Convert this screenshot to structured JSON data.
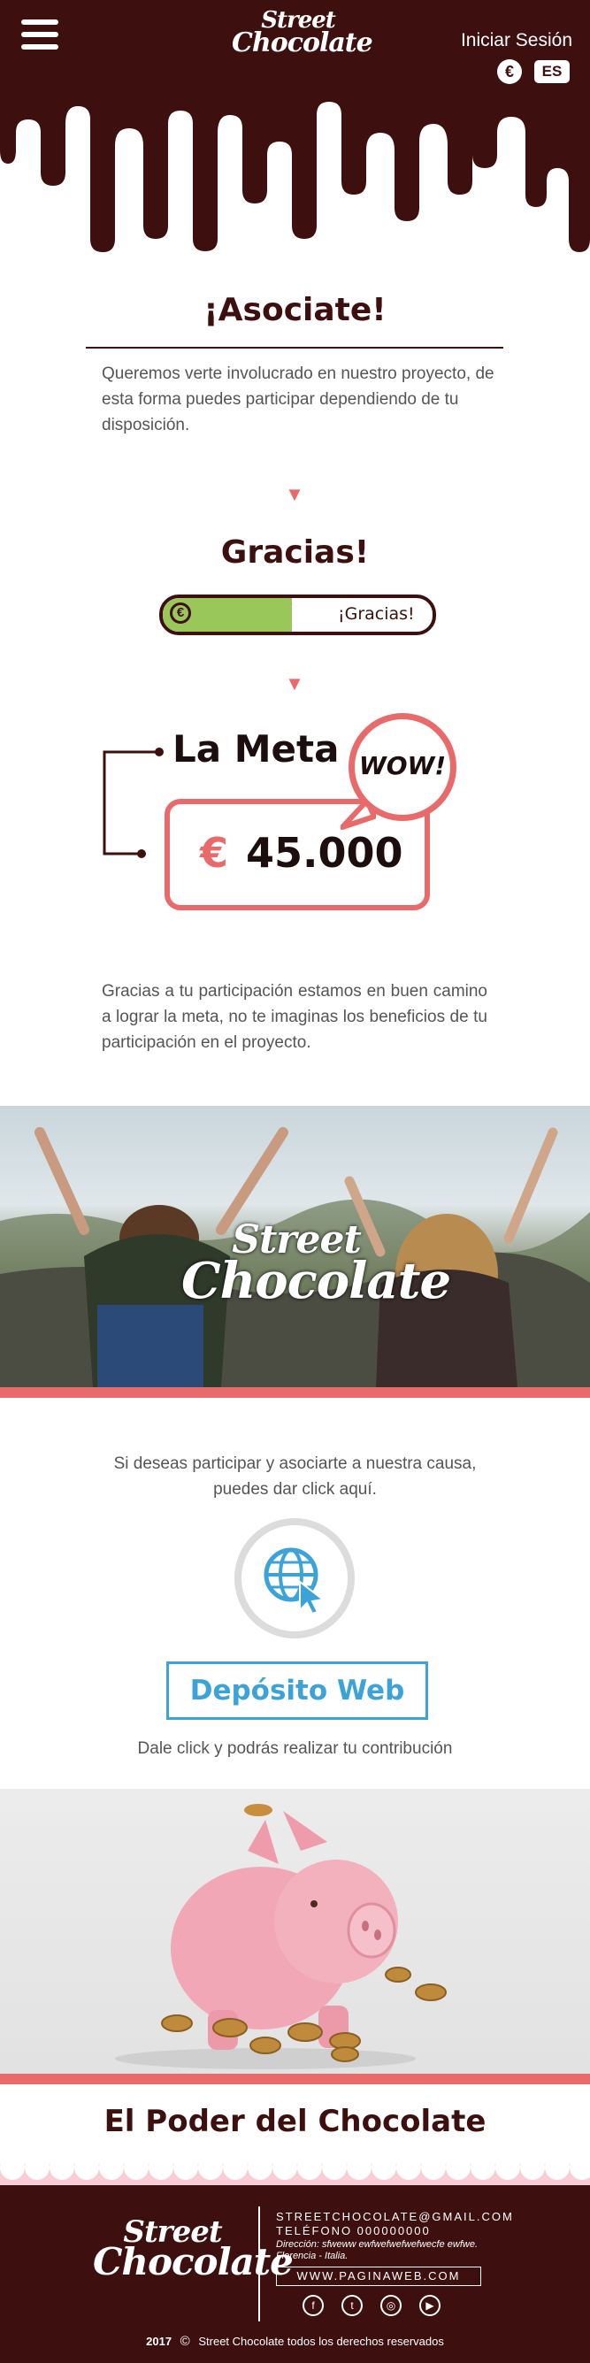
{
  "header": {
    "logo_line1": "Street",
    "logo_line2": "Chocolate",
    "login_label": "Iniciar Sesión",
    "currency_badge": "€",
    "language_badge": "ES"
  },
  "associate": {
    "title": "¡Asociate!",
    "text": "Queremos verte involucrado en nuestro proyecto, de esta forma puedes participar dependiendo de tu disposición."
  },
  "thanks": {
    "title": "Gracias!",
    "progress_label": "¡Gracias!",
    "progress_icon": "€",
    "progress_fraction": 0.48
  },
  "goal": {
    "title": "La Meta",
    "currency": "€",
    "amount": "45.000",
    "bubble": "WOW!"
  },
  "goal_text": "Gracias a tu participación estamos en buen camino a  lograr la meta, no te imaginas los beneficios de tu participación en el proyecto.",
  "banner": {
    "logo_line1": "Street",
    "logo_line2": "Chocolate"
  },
  "participate": {
    "text_line1": "Si deseas participar y asociarte a nuestra causa,",
    "text_line2": "puedes dar click aquí.",
    "icon": "globe-cursor-icon",
    "button_label": "Depósito Web",
    "caption": "Dale click y podrás realizar tu contribución"
  },
  "power_title": "El Poder del Chocolate",
  "footer": {
    "logo_line1": "Street",
    "logo_line2": "Chocolate",
    "email": "STREETCHOCOLATE@GMAIL.COM",
    "phone": "TELÉFONO 000000000",
    "address_line1": "Dirección: sfweww ewfwefwefwefwecfe ewfwe.",
    "address_line2": "Florencia - Italia.",
    "website": "WWW.PAGINAWEB.COM",
    "social": [
      "facebook-icon",
      "twitter-icon",
      "instagram-icon",
      "youtube-icon"
    ],
    "year": "2017",
    "copyright_symbol": "©",
    "copyright_text": "Street Chocolate todos los derechos reservados"
  },
  "colors": {
    "chocolate": "#3e0f0f",
    "accent": "#e86a6a",
    "progress": "#9ac75a",
    "link_blue": "#3ca3d8"
  }
}
